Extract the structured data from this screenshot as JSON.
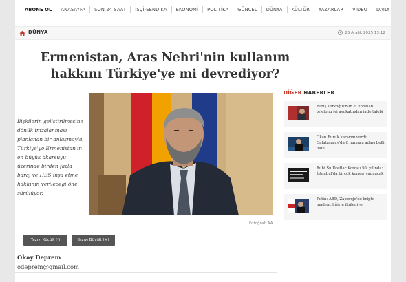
{
  "nav": {
    "items": [
      "ABONE OL",
      "ANASAYFA",
      "SON 24 SAAT",
      "İŞÇİ-SENDİKA",
      "EKONOMİ",
      "POLİTİKA",
      "GÜNCEL",
      "DÜNYA",
      "KÜLTÜR",
      "YAZARLAR",
      "VİDEO",
      "DAILY"
    ]
  },
  "section": {
    "name": "DÜNYA",
    "date": "25 Aralık 2025 13:12"
  },
  "article": {
    "title": "Ermenistan, Aras Nehri'nin kullanım hakkını Türkiye'ye mi devrediyor?",
    "spot": "İlişkilerin geliştirilmesine dönük imzalanması planlanan bir anlaşmayla, Türkiye'ye Ermenistan'ın en büyük akarsuyu üzerinde birden fazla baraj ve HES inşa etme hakkının verileceği öne sürülüyor.",
    "photo_credit": "Fotoğraf: AA"
  },
  "controls": {
    "smaller": "Yazıyı Küçült (-)",
    "bigger": "Yazıyı Büyült (+)"
  },
  "author": {
    "name": "Okay Deprem",
    "email": "odeprem@gmail.com"
  },
  "sidebar": {
    "heading_accent": "DİĞER",
    "heading_rest": " HABERLER",
    "items": [
      {
        "title": "Barış Terkoğlu'nun el konulan telefonu iyi avukatından iade talebi"
      },
      {
        "title": "Okan Buruk kararını verdi: Galatasaray'da 6 numara adayı belli oldu"
      },
      {
        "title": "Ruhi Su Dostlar Korosu 50. yılında: İstanbul'da birçok konser yapılacak"
      },
      {
        "title": "Putin: ABD, Zaporoje'de kripto madenciliğiyle ilgileniyor"
      }
    ]
  },
  "colors": {
    "accent": "#c0392b",
    "button": "#555555",
    "flag_red": "#d0212a",
    "flag_blue": "#1f3b8a",
    "flag_orange": "#f2a200"
  }
}
